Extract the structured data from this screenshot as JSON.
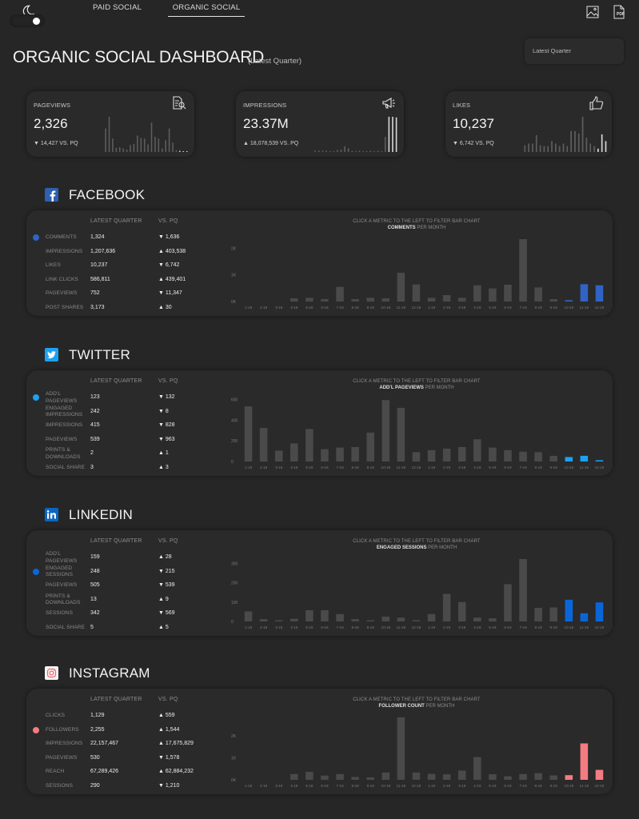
{
  "nav": {
    "tabs": [
      {
        "label": "PAID SOCIAL",
        "active": false
      },
      {
        "label": "ORGANIC SOCIAL",
        "active": true
      }
    ],
    "icons": [
      "moon-icon",
      "image-export-icon",
      "pdf-export-icon"
    ],
    "theme_toggle": "dark"
  },
  "header": {
    "title": "ORGANIC SOCIAL DASHBOARD",
    "subtitle": "(Latest Quarter)",
    "period_select": "Latest Quarter"
  },
  "kpis": [
    {
      "label": "PAGEVIEWS",
      "value": "2,326",
      "direction": "down",
      "change": "14,427 VS. PQ",
      "icon": "document-search-icon",
      "spark": [
        40,
        60,
        23,
        7,
        8,
        6,
        4,
        12,
        14,
        28,
        24,
        23,
        13,
        50,
        26,
        23,
        6,
        20,
        40,
        16,
        3,
        2,
        1,
        1
      ]
    },
    {
      "label": "IMPRESSIONS",
      "value": "23.37M",
      "direction": "up",
      "change": "18,078,539 VS. PQ",
      "icon": "megaphone-icon",
      "spark": [
        2,
        2,
        2,
        2,
        1,
        1,
        3,
        4,
        9,
        6,
        2,
        1,
        2,
        1,
        1,
        2,
        1,
        2,
        1,
        24,
        56,
        56,
        55
      ]
    },
    {
      "label": "LIKES",
      "value": "10,237",
      "direction": "down",
      "change": "6,742 VS. PQ",
      "icon": "thumbs-up-icon",
      "spark": [
        8,
        10,
        10,
        20,
        8,
        7,
        7,
        13,
        10,
        7,
        10,
        7,
        25,
        25,
        22,
        42,
        17,
        10,
        7,
        4,
        21,
        13
      ]
    }
  ],
  "sections": [
    {
      "name": "FACEBOOK",
      "icon": "facebook-icon",
      "color": "#2f64c4",
      "col_latest": "LATEST QUARTER",
      "col_vs": "VS. PQ",
      "metrics": [
        {
          "name": "COMMENTS",
          "value": "1,324",
          "direction": "down",
          "change": "1,636",
          "selected": true
        },
        {
          "name": "IMPRESSIONS",
          "value": "1,207,636",
          "direction": "up",
          "change": "403,538"
        },
        {
          "name": "LIKES",
          "value": "10,237",
          "direction": "down",
          "change": "6,742"
        },
        {
          "name": "LINK CLICKS",
          "value": "586,811",
          "direction": "up",
          "change": "439,401"
        },
        {
          "name": "PAGEVIEWS",
          "value": "752",
          "direction": "down",
          "change": "11,347"
        },
        {
          "name": "POST SHARES",
          "value": "3,173",
          "direction": "up",
          "change": "30"
        }
      ],
      "chart": {
        "hint": "CLICK A METRIC TO THE LEFT TO FILTER BAR CHART",
        "metric": "COMMENTS",
        "suffix": " PER MONTH"
      }
    },
    {
      "name": "TWITTER",
      "icon": "twitter-icon",
      "color": "#1da1f2",
      "col_latest": "LATEST QUARTER",
      "col_vs": "VS. PQ",
      "metrics": [
        {
          "name": "ADD'L PAGEVIEWS",
          "value": "123",
          "direction": "down",
          "change": "132",
          "selected": true
        },
        {
          "name": "ENGAGED IMPRESSIONS",
          "value": "242",
          "direction": "down",
          "change": "8"
        },
        {
          "name": "IMPRESSIONS",
          "value": "415",
          "direction": "down",
          "change": "828"
        },
        {
          "name": "PAGEVIEWS",
          "value": "539",
          "direction": "down",
          "change": "963"
        },
        {
          "name": "PRINTS & DOWNLOADS",
          "value": "2",
          "direction": "up",
          "change": "1"
        },
        {
          "name": "SOCIAL SHARE",
          "value": "3",
          "direction": "up",
          "change": "3"
        }
      ],
      "chart": {
        "hint": "CLICK A METRIC TO THE LEFT TO FILTER BAR CHART",
        "metric": "ADD'L PAGEVIEWS",
        "suffix": " PER MONTH"
      }
    },
    {
      "name": "LINKEDIN",
      "icon": "linkedin-icon",
      "color": "#0a66d8",
      "col_latest": "LATEST QUARTER",
      "col_vs": "VS. PQ",
      "metrics": [
        {
          "name": "ADD'L PAGEVIEWS",
          "value": "159",
          "direction": "up",
          "change": "28"
        },
        {
          "name": "ENGAGED SESSIONS",
          "value": "248",
          "direction": "down",
          "change": "215",
          "selected": true
        },
        {
          "name": "PAGEVIEWS",
          "value": "505",
          "direction": "down",
          "change": "539"
        },
        {
          "name": "PRINTS & DOWNLOADS",
          "value": "13",
          "direction": "up",
          "change": "9"
        },
        {
          "name": "SESSIONS",
          "value": "342",
          "direction": "down",
          "change": "569"
        },
        {
          "name": "SOCIAL SHARE",
          "value": "5",
          "direction": "up",
          "change": "5"
        }
      ],
      "chart": {
        "hint": "CLICK A METRIC TO THE LEFT TO FILTER BAR CHART",
        "metric": "ENGAGED SESSIONS",
        "suffix": " PER MONTH"
      }
    },
    {
      "name": "INSTAGRAM",
      "icon": "instagram-icon",
      "color": "#f47c80",
      "col_latest": "LATEST QUARTER",
      "col_vs": "VS. PQ",
      "metrics": [
        {
          "name": "CLICKS",
          "value": "1,129",
          "direction": "up",
          "change": "559"
        },
        {
          "name": "FOLLOWERS",
          "value": "2,255",
          "direction": "up",
          "change": "1,544",
          "selected": true
        },
        {
          "name": "IMPRESSIONS",
          "value": "22,157,467",
          "direction": "up",
          "change": "17,675,829"
        },
        {
          "name": "PAGEVIEWS",
          "value": "530",
          "direction": "down",
          "change": "1,578"
        },
        {
          "name": "REACH",
          "value": "67,289,426",
          "direction": "up",
          "change": "62,884,232"
        },
        {
          "name": "SESSIONS",
          "value": "290",
          "direction": "down",
          "change": "1,210"
        }
      ],
      "chart": {
        "hint": "CLICK A METRIC TO THE LEFT TO FILTER BAR CHART",
        "metric": "FOLLOWER COUNT",
        "suffix": " PER MONTH"
      }
    }
  ],
  "chart_data": [
    {
      "type": "bar",
      "title": "COMMENTS PER MONTH",
      "categories": [
        "1-18",
        "2-18",
        "3-18",
        "4-18",
        "5-18",
        "6-18",
        "7-18",
        "8-18",
        "9-18",
        "10-18",
        "11-18",
        "12-18",
        "1-19",
        "2-19",
        "3-19",
        "4-19",
        "5-19",
        "6-19",
        "7-19",
        "8-19",
        "9-19",
        "10-19",
        "11-19",
        "12-19"
      ],
      "values": [
        0,
        0,
        0,
        120,
        140,
        90,
        550,
        90,
        140,
        120,
        1080,
        640,
        140,
        240,
        140,
        610,
        490,
        630,
        2340,
        530,
        90,
        50,
        650,
        610
      ],
      "highlight_last": 3,
      "yticks": [
        "0K",
        "1K",
        "2K"
      ],
      "ylim": [
        0,
        2400
      ]
    },
    {
      "type": "bar",
      "title": "ADD'L PAGEVIEWS PER MONTH",
      "categories": [
        "1-18",
        "2-18",
        "3-18",
        "4-18",
        "5-18",
        "6-18",
        "7-18",
        "8-18",
        "9-18",
        "10-18",
        "11-18",
        "12-18",
        "1-19",
        "2-19",
        "3-19",
        "4-19",
        "5-19",
        "6-19",
        "7-19",
        "8-19",
        "9-19",
        "10-19",
        "11-19",
        "12-19"
      ],
      "values": [
        535,
        325,
        105,
        175,
        315,
        120,
        135,
        140,
        280,
        595,
        520,
        90,
        110,
        125,
        140,
        215,
        135,
        110,
        95,
        90,
        55,
        43,
        55,
        12
      ],
      "highlight_last": 3,
      "yticks": [
        "0",
        "200",
        "400",
        "600"
      ],
      "ylim": [
        0,
        620
      ]
    },
    {
      "type": "bar",
      "title": "ENGAGED SESSIONS PER MONTH",
      "categories": [
        "1-18",
        "2-18",
        "3-18",
        "4-18",
        "5-18",
        "6-18",
        "7-18",
        "8-18",
        "9-18",
        "10-18",
        "11-18",
        "12-18",
        "1-19",
        "2-19",
        "3-19",
        "4-19",
        "5-19",
        "6-19",
        "7-19",
        "8-19",
        "9-19",
        "10-19",
        "11-19",
        "12-19"
      ],
      "values": [
        52,
        12,
        5,
        14,
        58,
        58,
        38,
        12,
        5,
        25,
        20,
        5,
        38,
        142,
        100,
        20,
        16,
        192,
        322,
        70,
        72,
        112,
        42,
        98
      ],
      "highlight_last": 3,
      "yticks": [
        "0",
        "100",
        "200",
        "300"
      ],
      "ylim": [
        0,
        330
      ]
    },
    {
      "type": "bar",
      "title": "FOLLOWER COUNT PER MONTH",
      "categories": [
        "1-18",
        "2-18",
        "3-18",
        "4-18",
        "5-18",
        "6-18",
        "7-18",
        "8-18",
        "9-18",
        "10-18",
        "11-18",
        "12-18",
        "1-19",
        "2-19",
        "3-19",
        "4-19",
        "5-19",
        "6-19",
        "7-19",
        "8-19",
        "9-19",
        "10-19",
        "11-19",
        "12-19"
      ],
      "values": [
        0,
        0,
        0,
        260,
        360,
        190,
        260,
        130,
        110,
        330,
        2830,
        330,
        270,
        250,
        420,
        1030,
        250,
        160,
        260,
        300,
        200,
        210,
        1650,
        450
      ],
      "highlight_last": 3,
      "yticks": [
        "0K",
        "1K",
        "2K"
      ],
      "ylim": [
        0,
        2900
      ]
    }
  ]
}
